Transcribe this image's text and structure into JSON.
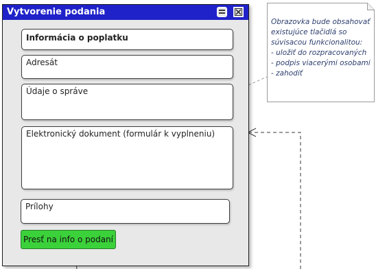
{
  "window": {
    "title": "Vytvorenie podania",
    "restore_icon": "restore-icon",
    "close_icon": "close-icon"
  },
  "panels": {
    "fee_info": "Informácia o poplatku",
    "recipient": "Adresát",
    "message_details": "Údaje o správe",
    "electronic_document": "Elektronický dokument (formulár k vyplneniu)",
    "attachments": "Prílohy"
  },
  "go_button": "Presť na info o podaní",
  "note": {
    "lines": [
      "Obrazovka bude obsahovať",
      "existujúce tlačidlá so",
      "súvisacou funkcionalitou:",
      "- uložiť do rozpracovaných",
      "- podpis viacerými osobami",
      "- zahodiť"
    ]
  },
  "colors": {
    "title_bar": "#1f22c9",
    "window_body": "#e8e8e8",
    "button_green": "#3bd13a",
    "note_text": "#2d3e6e"
  }
}
